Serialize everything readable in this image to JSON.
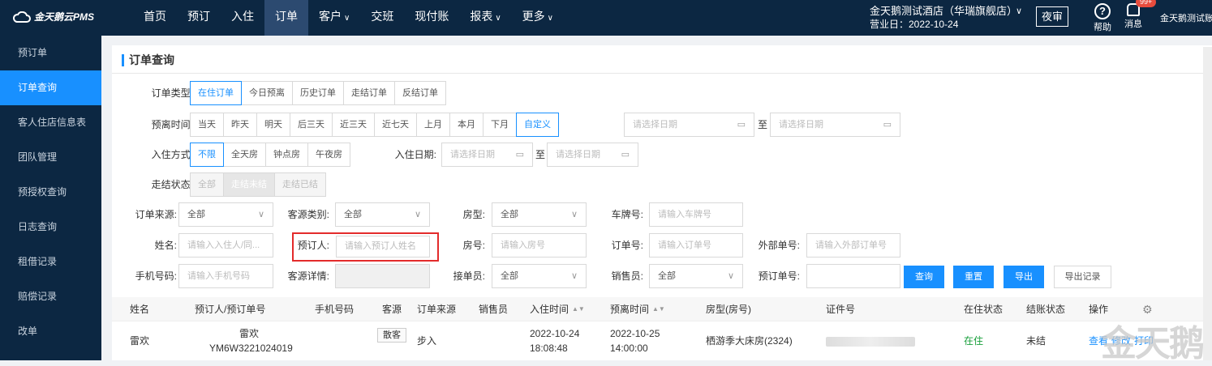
{
  "app": {
    "logo": "金天鹅云PMS"
  },
  "nav": [
    {
      "label": "首页"
    },
    {
      "label": "预订"
    },
    {
      "label": "入住"
    },
    {
      "label": "订单"
    },
    {
      "label": "客户",
      "dropdown": true
    },
    {
      "label": "交班"
    },
    {
      "label": "现付账"
    },
    {
      "label": "报表",
      "dropdown": true
    },
    {
      "label": "更多",
      "dropdown": true
    }
  ],
  "nav_active": "订单",
  "header": {
    "hotel_name": "金天鹅测试酒店（华瑞旗舰店）",
    "business_date": "营业日：2022-10-24",
    "night_audit": "夜审",
    "help": "帮助",
    "messages": "消息",
    "message_badge": "99+",
    "user": "金天鹅测试账"
  },
  "sidebar": [
    {
      "label": "预订单"
    },
    {
      "label": "订单查询",
      "active": true
    },
    {
      "label": "客人住店信息表"
    },
    {
      "label": "团队管理"
    },
    {
      "label": "预授权查询"
    },
    {
      "label": "日志查询"
    },
    {
      "label": "租借记录"
    },
    {
      "label": "赔偿记录"
    },
    {
      "label": "改单"
    }
  ],
  "page_title": "订单查询",
  "filters": {
    "order_type": {
      "label": "订单类型:",
      "options": [
        "在住订单",
        "今日预离",
        "历史订单",
        "走结订单",
        "反结订单"
      ],
      "selected": "在住订单"
    },
    "departure_time": {
      "label": "预离时间:",
      "options": [
        "当天",
        "昨天",
        "明天",
        "后三天",
        "近三天",
        "近七天",
        "上月",
        "本月",
        "下月",
        "自定义"
      ],
      "selected": "自定义",
      "date_placeholder": "请选择日期",
      "to": "至"
    },
    "checkin_mode": {
      "label": "入住方式:",
      "options": [
        "不限",
        "全天房",
        "钟点房",
        "午夜房"
      ],
      "selected": "不限"
    },
    "checkin_date": {
      "label": "入住日期:",
      "placeholder": "请选择日期",
      "to": "至"
    },
    "checkout_status": {
      "label": "走结状态:",
      "options": [
        "全部",
        "走结未结",
        "走结已结"
      ],
      "selected": "走结未结"
    },
    "order_source": {
      "label": "订单来源:",
      "value": "全部"
    },
    "guest_source_type": {
      "label": "客源类别:",
      "value": "全部"
    },
    "room_type": {
      "label": "房型:",
      "value": "全部"
    },
    "plate_no": {
      "label": "车牌号:",
      "placeholder": "请输入车牌号"
    },
    "name": {
      "label": "姓名:",
      "placeholder": "请输入入住人/同..."
    },
    "booker": {
      "label": "预订人:",
      "placeholder": "请输入预订人姓名"
    },
    "room_no": {
      "label": "房号:",
      "placeholder": "请输入房号"
    },
    "order_no": {
      "label": "订单号:",
      "placeholder": "请输入订单号"
    },
    "external_no": {
      "label": "外部单号:",
      "placeholder": "请输入外部订单号"
    },
    "phone": {
      "label": "手机号码:",
      "placeholder": "请输入手机号码"
    },
    "source_detail": {
      "label": "客源详情:"
    },
    "receiver": {
      "label": "接单员:",
      "value": "全部"
    },
    "salesperson": {
      "label": "销售员:",
      "value": "全部"
    },
    "booking_no": {
      "label": "预订单号:"
    }
  },
  "actions": {
    "query": "查询",
    "reset": "重置",
    "export": "导出",
    "export_log": "导出记录"
  },
  "table": {
    "headers": [
      "姓名",
      "预订人/预订单号",
      "手机号码",
      "客源",
      "订单来源",
      "销售员",
      "入住时间",
      "预离时间",
      "房型(房号)",
      "证件号",
      "在住状态",
      "结账状态",
      "操作"
    ],
    "rows": [
      {
        "name": "雷欢",
        "booker": "雷欢",
        "booking_no": "YM6W3221024019",
        "phone": "",
        "source": "散客",
        "order_source": "步入",
        "salesperson": "",
        "checkin_date": "2022-10-24",
        "checkin_time": "18:08:48",
        "departure_date": "2022-10-25",
        "departure_time": "14:00:00",
        "room": "栖游季大床房(2324)",
        "stay_status": "在住",
        "settle_status": "未结",
        "ops": [
          "查看",
          "修改",
          "打印"
        ]
      }
    ]
  },
  "colors": {
    "topbar": "#0c2742",
    "accent": "#1890ff",
    "highlight": "#e32b2b",
    "in_house": "#1aa03c"
  },
  "watermark": "金天鹅"
}
